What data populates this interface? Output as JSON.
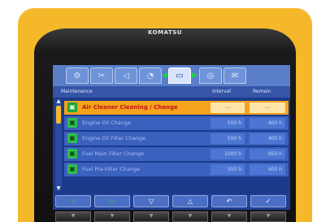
{
  "brand": "KOMATSU",
  "tabs": [
    {
      "icon": "wrench-icon",
      "glyph": "⚙"
    },
    {
      "icon": "tools-icon",
      "glyph": "✂"
    },
    {
      "icon": "triangle-icon",
      "glyph": "◁"
    },
    {
      "icon": "gauge-icon",
      "glyph": "◔"
    },
    {
      "icon": "maintenance-icon",
      "glyph": "▭",
      "active": true
    },
    {
      "icon": "monitor-icon",
      "glyph": "◎"
    },
    {
      "icon": "message-icon",
      "glyph": "✉"
    }
  ],
  "header": {
    "name": "Maintenance",
    "interval": "Interval",
    "remain": "Remain"
  },
  "rows": [
    {
      "name": "Air Cleaner Cleaning / Change",
      "interval": "---",
      "remain": "---",
      "selected": true
    },
    {
      "name": "Engine Oil Change",
      "interval": "500 h",
      "remain": "400 h"
    },
    {
      "name": "Engine Oil Filter Change",
      "interval": "500 h",
      "remain": "400 h"
    },
    {
      "name": "Fuel Main Filter Change",
      "interval": "1000 h",
      "remain": "950 h"
    },
    {
      "name": "Fuel Pre-Filter Change",
      "interval": "500 h",
      "remain": "400 h"
    }
  ],
  "softkeys": [
    {
      "glyph": "◁",
      "name": "left"
    },
    {
      "glyph": "▷",
      "name": "right"
    },
    {
      "glyph": "▽",
      "name": "down"
    },
    {
      "glyph": "△",
      "name": "up"
    },
    {
      "glyph": "↶",
      "name": "back"
    },
    {
      "glyph": "✓",
      "name": "confirm"
    }
  ],
  "hw_glyph": "▼",
  "colors": {
    "body_yellow": "#f5b82a",
    "screen_blue": "#1b3a8c",
    "row_blue": "#3b61bf",
    "selected_orange": "#f5a21c",
    "selected_text": "#c21818",
    "icon_green": "#2fbf4a"
  }
}
